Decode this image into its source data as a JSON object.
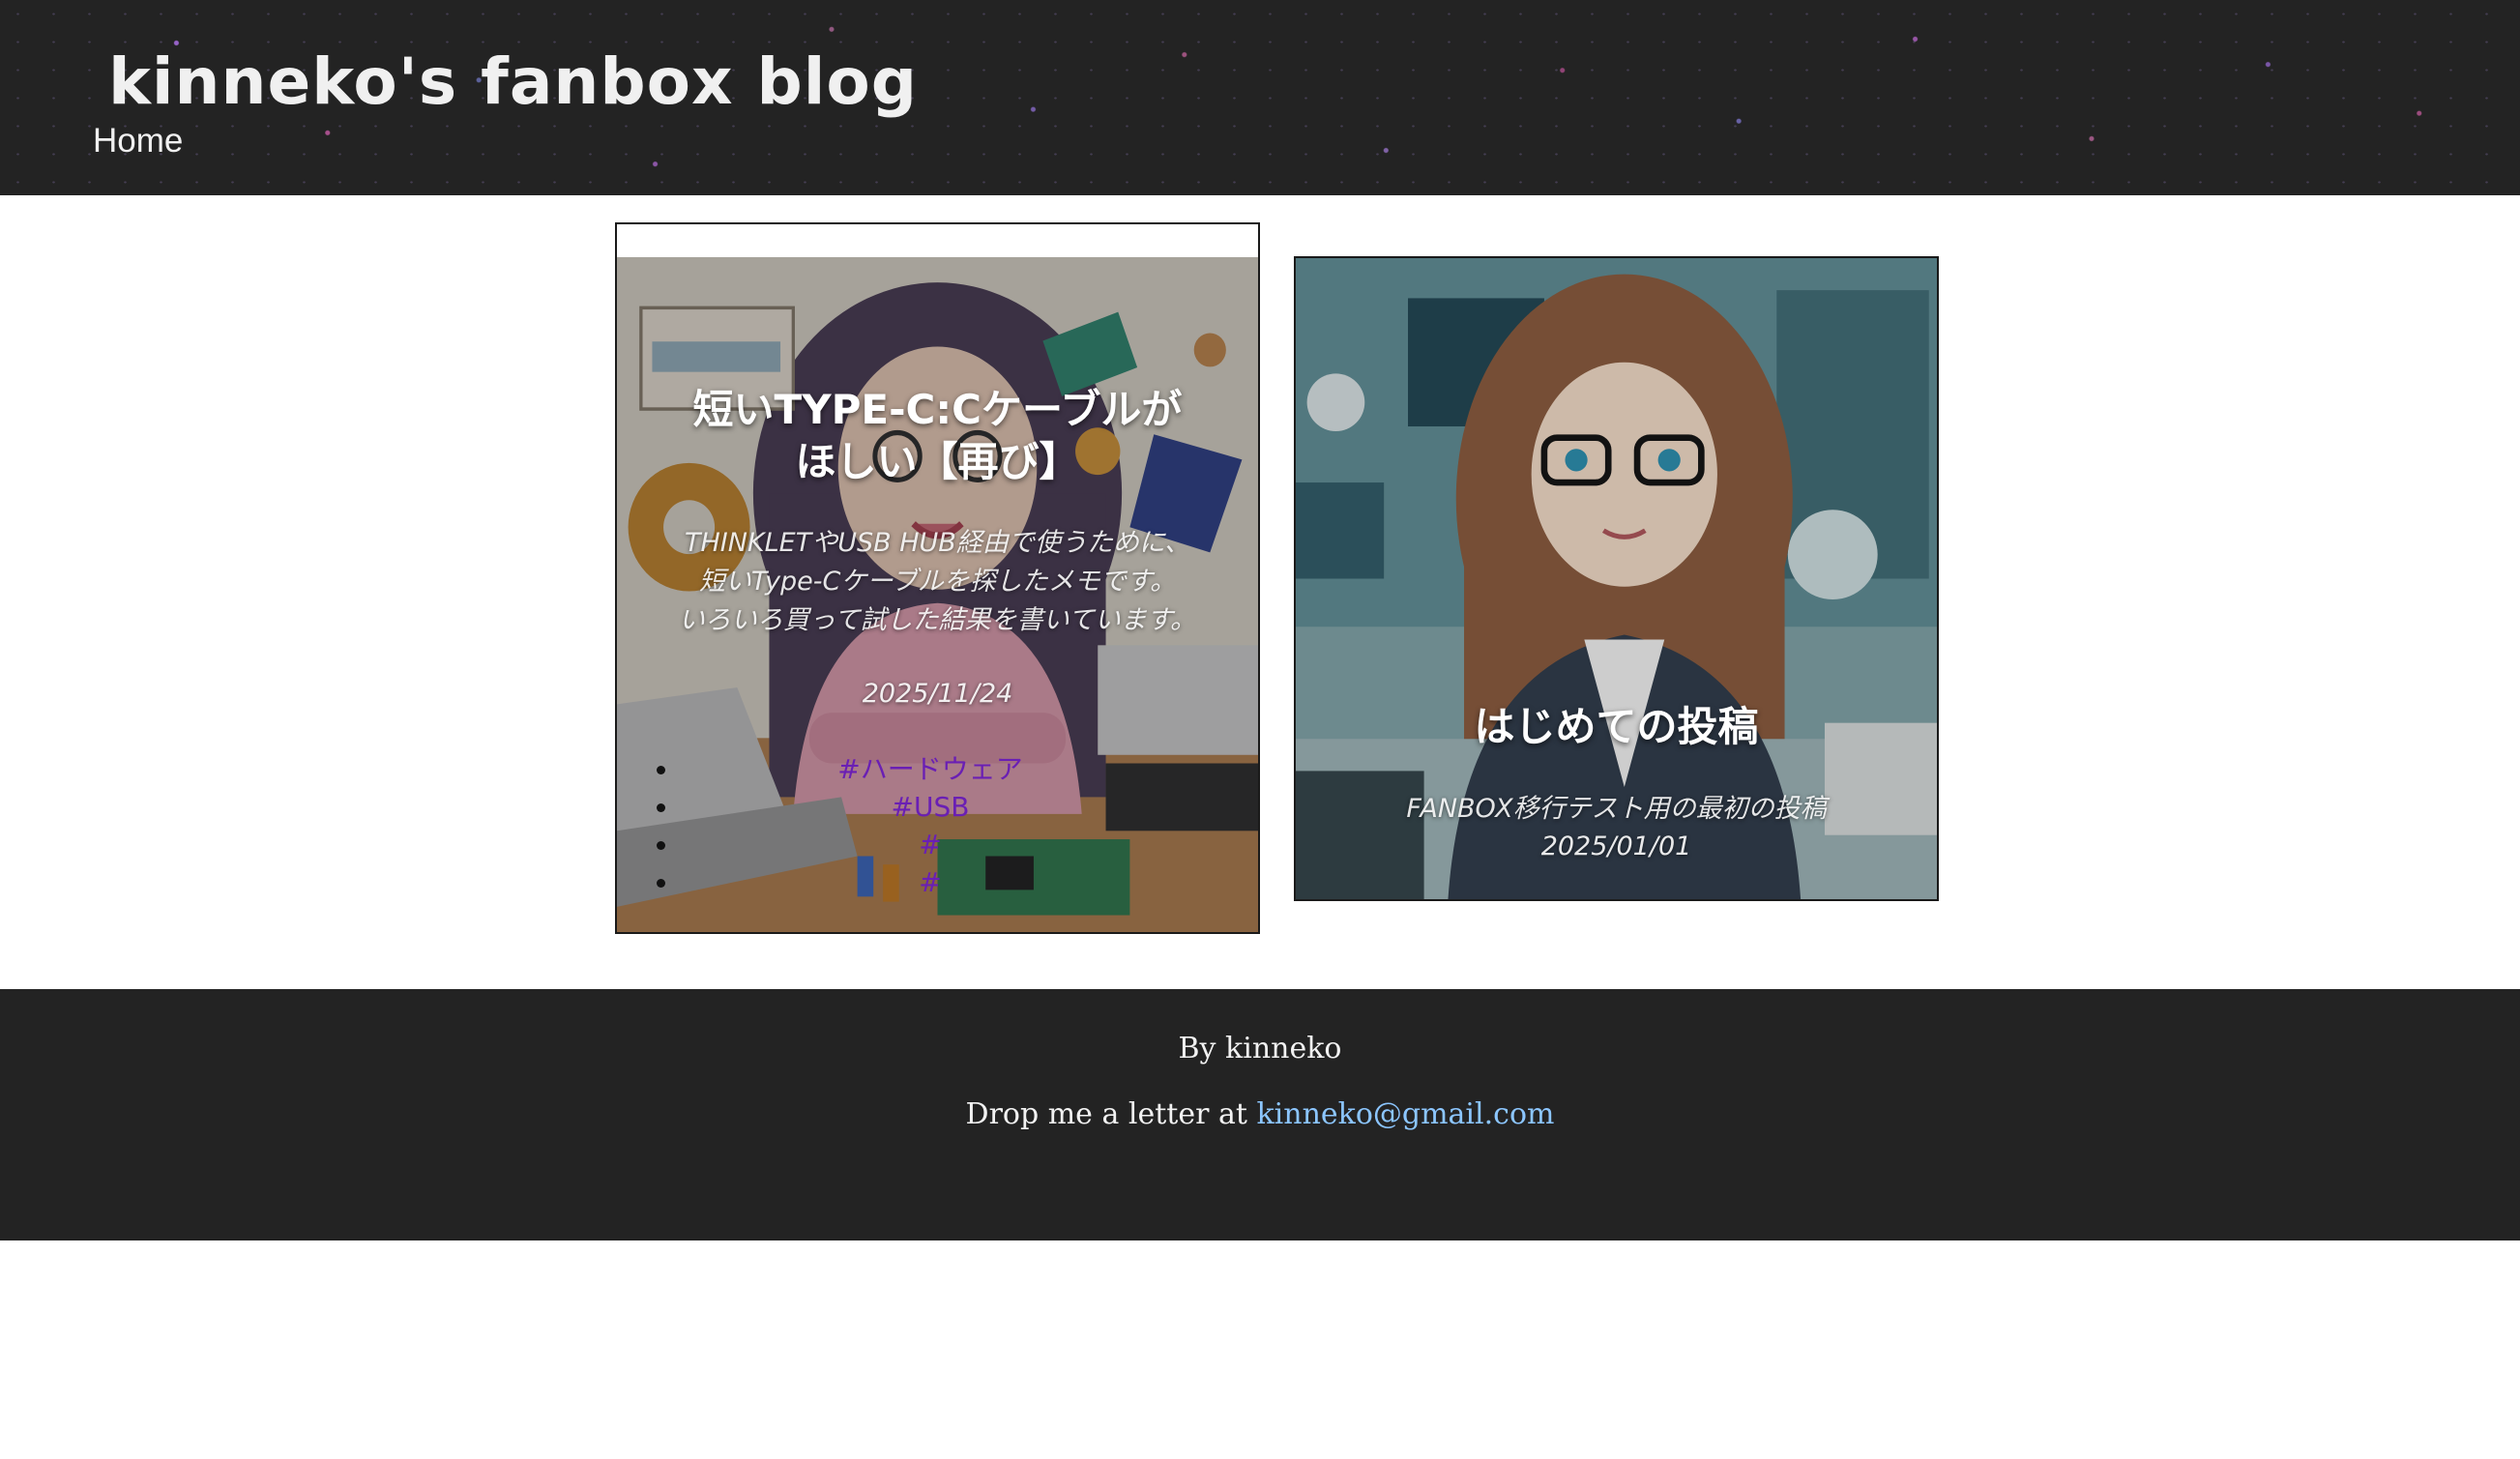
{
  "header": {
    "site_title": "kinneko's fanbox blog",
    "nav_home": "Home"
  },
  "posts": [
    {
      "title_line1": "短いTYPE-C:Cケーブルが",
      "title_line2": "ほしい【再び】",
      "desc_line1": "THINKLETやUSB HUB経由で使うために、",
      "desc_line2": "短いType-Cケーブルを探したメモです。",
      "desc_line3": "いろいろ買って試した結果を書いています。",
      "date": "2025/11/24",
      "tags": [
        "#ハードウェア",
        "#USB",
        "#",
        "#"
      ]
    },
    {
      "title": "はじめての投稿",
      "description": "FANBOX移行テスト用の最初の投稿",
      "date": "2025/01/01"
    }
  ],
  "footer": {
    "by": "By kinneko",
    "contact_prefix": "Drop me a letter at ",
    "email": "kinneko@gmail.com"
  },
  "colors": {
    "header_bg": "#232323",
    "footer_bg": "#232323",
    "link": "#8cc6ff",
    "tag": "#6a1fb4"
  }
}
